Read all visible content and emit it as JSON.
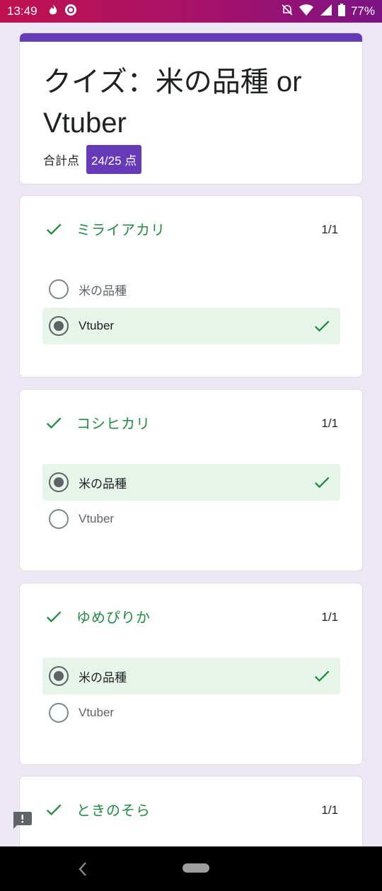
{
  "status_bar": {
    "time": "13:49",
    "battery": "77%",
    "icons": [
      "flame-icon",
      "refresh-circle-icon",
      "bell-off-icon",
      "wifi-icon",
      "signal-icon",
      "battery-icon"
    ]
  },
  "form": {
    "title": "クイズ：米の品種 or Vtuber",
    "score_label": "合計点",
    "score_value": "24/25 点",
    "accent_color": "#673ab7"
  },
  "questions": [
    {
      "title": "ミライアカリ",
      "points": "1/1",
      "options": [
        {
          "label": "米の品種",
          "selected": false,
          "correct_mark": false
        },
        {
          "label": "Vtuber",
          "selected": true,
          "correct_mark": true
        }
      ]
    },
    {
      "title": "コシヒカリ",
      "points": "1/1",
      "options": [
        {
          "label": "米の品種",
          "selected": true,
          "correct_mark": true
        },
        {
          "label": "Vtuber",
          "selected": false,
          "correct_mark": false
        }
      ]
    },
    {
      "title": "ゆめぴりか",
      "points": "1/1",
      "options": [
        {
          "label": "米の品種",
          "selected": true,
          "correct_mark": true
        },
        {
          "label": "Vtuber",
          "selected": false,
          "correct_mark": false
        }
      ]
    },
    {
      "title": "ときのそら",
      "points": "1/1"
    }
  ],
  "colors": {
    "correct_green": "#1e8e3e",
    "selected_bg": "#e6f4ea",
    "page_bg": "#ede7f6"
  },
  "nav": {
    "icons": [
      "back-icon",
      "home-pill-icon"
    ]
  }
}
